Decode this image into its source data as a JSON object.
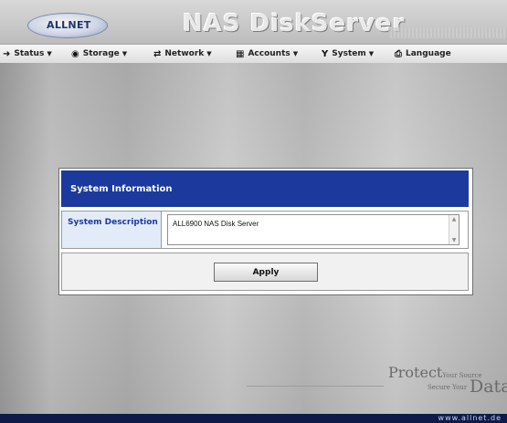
{
  "header": {
    "logo_text": "ALLNET",
    "app_title": "NAS DiskServer"
  },
  "menu": [
    {
      "label": "Status",
      "icon": "arrow-icon",
      "has_dropdown": true
    },
    {
      "label": "Storage",
      "icon": "disc-icon",
      "has_dropdown": true
    },
    {
      "label": "Network",
      "icon": "network-icon",
      "has_dropdown": true
    },
    {
      "label": "Accounts",
      "icon": "users-icon",
      "has_dropdown": true
    },
    {
      "label": "System",
      "icon": "tools-icon",
      "has_dropdown": true
    },
    {
      "label": "Language",
      "icon": "language-icon",
      "has_dropdown": false
    }
  ],
  "panel": {
    "title": "System Information",
    "field_label": "System Description",
    "field_value": "ALL6900 NAS Disk Server",
    "apply_label": "Apply"
  },
  "branding": {
    "protect": "Protect",
    "your_source": "Your Source",
    "secure_your": "Secure Your",
    "data": "Data",
    "footer_url": "www.allnet.de"
  },
  "colors": {
    "panel_header": "#1c3a9e",
    "label_bg": "#e3ebf8",
    "footer": "#0f1a4a"
  }
}
